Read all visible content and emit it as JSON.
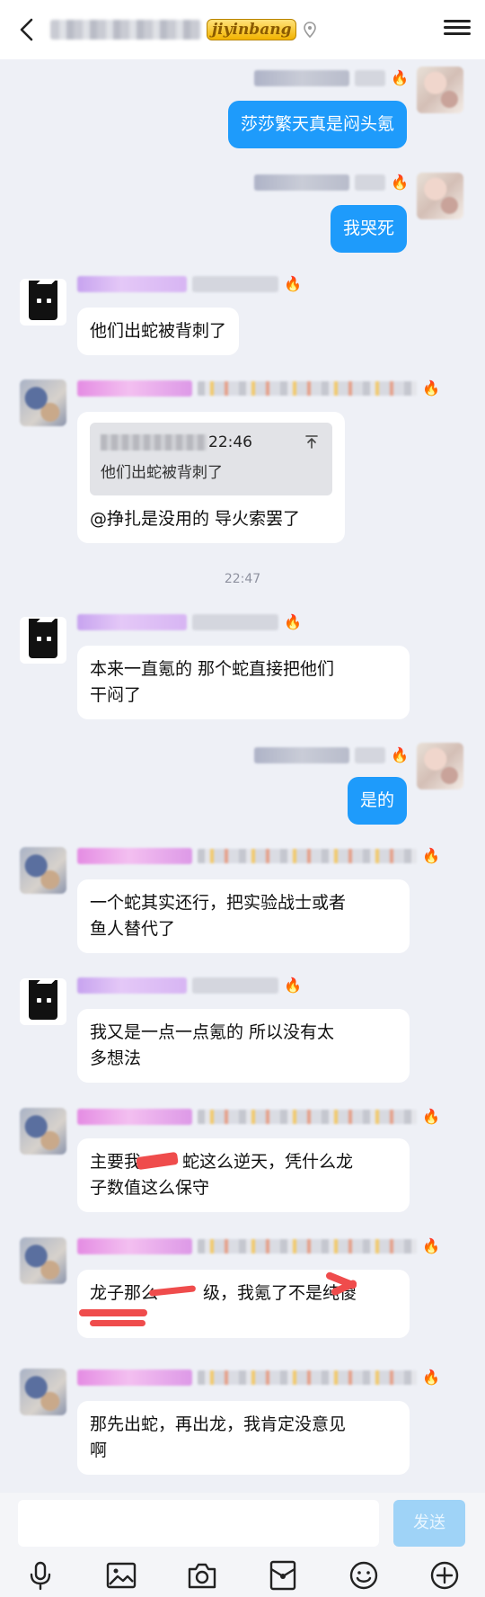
{
  "header": {
    "badge": "jiyinbang",
    "back_icon": "chevron-left-icon",
    "menu_icon": "hamburger-menu-icon"
  },
  "messages": {
    "m1": {
      "text": "莎莎繁天真是闷头氪"
    },
    "m2": {
      "text": "我哭死"
    },
    "m3": {
      "text": "他们出蛇被背刺了"
    },
    "m4": {
      "quote_time": "22:46",
      "quote_text": "他们出蛇被背刺了",
      "text": "@挣扎是没用的 导火索罢了"
    },
    "timestamp": "22:47",
    "m5": {
      "line1": "本来一直氪的 那个蛇直接把他们",
      "line2": "干闷了"
    },
    "m6": {
      "text": "是的"
    },
    "m7": {
      "line1": "一个蛇其实还行，把实验战士或者",
      "line2": "鱼人替代了"
    },
    "m8": {
      "line1": "我又是一点一点氪的 所以没有太",
      "line2": "多想法"
    },
    "m9": {
      "line1": "主要我",
      "line1b": "蛇这么逆天，凭什么龙",
      "line2": "子数值这么保守"
    },
    "m10": {
      "line1a": "龙子那么",
      "line1b": "级，我氪了不是纯傻"
    },
    "m11": {
      "line1": "那先出蛇，再出龙，我肯定没意见",
      "line2": "啊"
    }
  },
  "input": {
    "placeholder": "",
    "send_label": "发送"
  },
  "toolbar": {
    "icons": [
      "microphone-icon",
      "image-icon",
      "camera-icon",
      "red-packet-icon",
      "emoji-icon",
      "plus-icon"
    ]
  },
  "colors": {
    "my_bubble": "#1e9bfb",
    "send_button": "#9fd3f7",
    "background": "#eef0f6"
  }
}
